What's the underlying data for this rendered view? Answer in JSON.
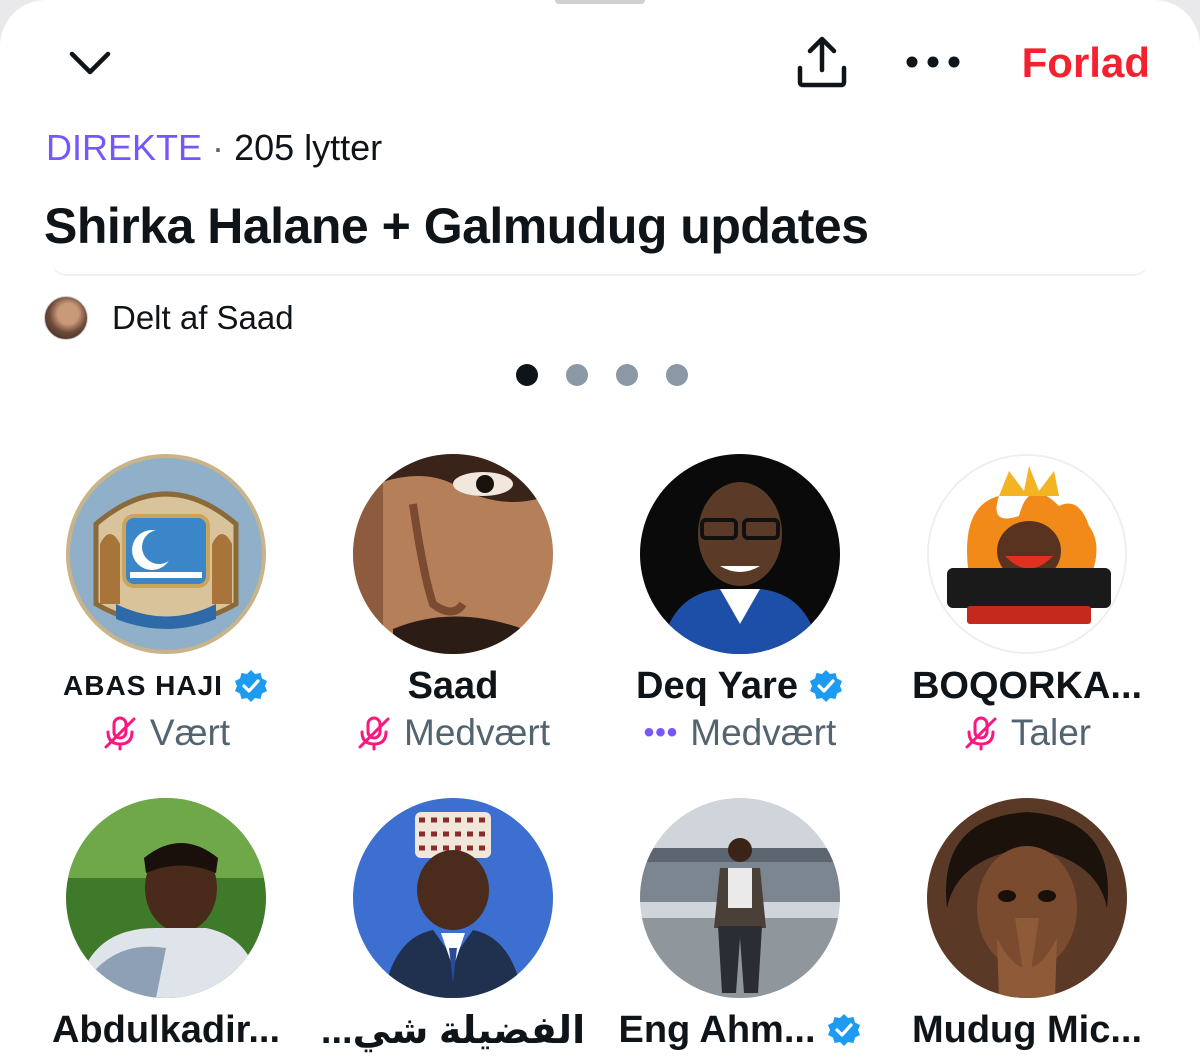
{
  "header": {
    "leave_label": "Forlad",
    "collapse_icon": "chevron-down-icon",
    "share_icon": "share-icon",
    "more_icon": "more-icon"
  },
  "space": {
    "live_label": "DIREKTE",
    "separator": "·",
    "listeners": "205 lytter",
    "title": "Shirka Halane + Galmudug updates",
    "shared_by": "Delt af Saad"
  },
  "pager": {
    "pages": 4,
    "current": 1
  },
  "participants": [
    {
      "name": "ABAS HAJI",
      "role": "Vært",
      "verified": true,
      "mic": "muted"
    },
    {
      "name": "Saad",
      "role": "Medvært",
      "verified": false,
      "mic": "muted"
    },
    {
      "name": "Deq Yare",
      "role": "Medvært",
      "verified": true,
      "mic": "connecting"
    },
    {
      "name": "BOQORKA...",
      "role": "Taler",
      "verified": false,
      "mic": "muted"
    },
    {
      "name": "Abdulkadir...",
      "role": "",
      "verified": false
    },
    {
      "name": "الفضيلة شي...",
      "role": "",
      "verified": false
    },
    {
      "name": "Eng Ahm...",
      "role": "",
      "verified": true
    },
    {
      "name": "Mudug Mic...",
      "role": "",
      "verified": false
    }
  ],
  "colors": {
    "live": "#7856ff",
    "leave": "#f4212e",
    "verified": "#1d9bf0",
    "mic_muted": "#f91880",
    "muted_text": "#536471"
  }
}
